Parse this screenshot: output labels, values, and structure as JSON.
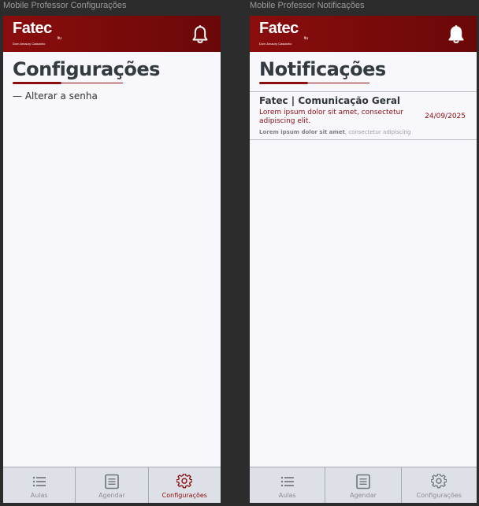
{
  "frames": {
    "config_label": "Mobile Professor Configurações",
    "notif_label": "Mobile Professor Notificações"
  },
  "brand": {
    "name": "Fatec",
    "city": "Itu",
    "subtitle": "Dom Amaury Castanho"
  },
  "colors": {
    "primary": "#8b0d0d",
    "background": "#f7f7fc",
    "tabbar": "#dde0e7"
  },
  "config_screen": {
    "title": "Configurações",
    "items": [
      {
        "label": "— Alterar a senha"
      }
    ],
    "active_tab": "Configurações"
  },
  "notif_screen": {
    "title": "Notificações",
    "notifications": [
      {
        "title": "Fatec | Comunicação Geral",
        "body": "Lorem ipsum dolor sit amet, consectetur adipiscing elit.",
        "date": "24/09/2025",
        "footer_bold": "Lorem ipsum dolor sit amet",
        "footer_light": ", consectetur adipiscing"
      }
    ],
    "active_tab": "none"
  },
  "tabbar": {
    "tabs": [
      {
        "label": "Aulas",
        "icon": "list-icon"
      },
      {
        "label": "Agendar",
        "icon": "document-icon"
      },
      {
        "label": "Configurações",
        "icon": "gear-icon"
      }
    ]
  }
}
